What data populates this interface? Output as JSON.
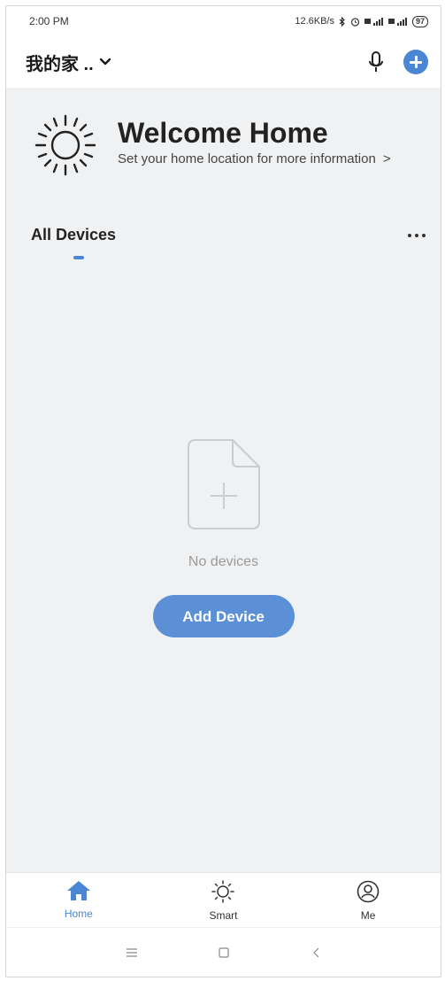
{
  "status_bar": {
    "time": "2:00 PM",
    "network_speed": "12.6KB/s",
    "battery": "97"
  },
  "header": {
    "home_name": "我的家 ..",
    "icons": [
      "chevron-down-icon",
      "microphone-icon",
      "add-circle-icon"
    ]
  },
  "welcome": {
    "title": "Welcome Home",
    "subtitle": "Set your home location for more information",
    "arrow": ">"
  },
  "devices": {
    "title": "All Devices",
    "empty_text": "No devices",
    "add_button": "Add Device"
  },
  "bottom_nav": {
    "items": [
      {
        "label": "Home",
        "icon": "home-icon",
        "active": true
      },
      {
        "label": "Smart",
        "icon": "sun-icon",
        "active": false
      },
      {
        "label": "Me",
        "icon": "user-icon",
        "active": false
      }
    ]
  },
  "colors": {
    "accent": "#4a86d4",
    "background": "#f0f1f3"
  }
}
